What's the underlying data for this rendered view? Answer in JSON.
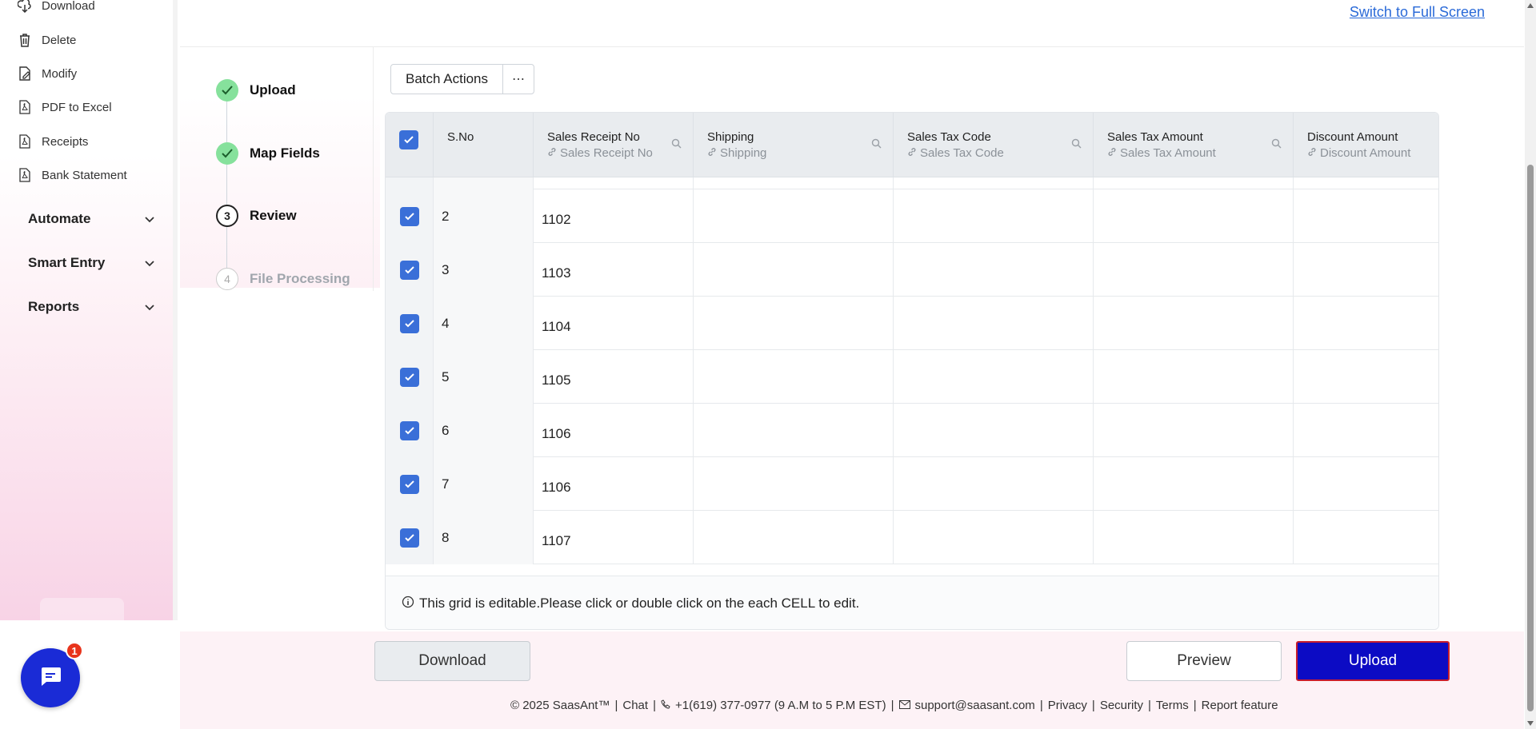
{
  "sidebar": {
    "items": [
      {
        "label": "Download",
        "icon": "cloud-download-icon"
      },
      {
        "label": "Delete",
        "icon": "trash-icon"
      },
      {
        "label": "Modify",
        "icon": "edit-file-icon"
      },
      {
        "label": "PDF to Excel",
        "icon": "pdf-file-icon"
      },
      {
        "label": "Receipts",
        "icon": "pdf-file-icon"
      },
      {
        "label": "Bank Statement",
        "icon": "pdf-file-icon"
      }
    ],
    "groups": [
      {
        "label": "Automate"
      },
      {
        "label": "Smart Entry"
      },
      {
        "label": "Reports"
      }
    ]
  },
  "chat": {
    "badge": "1"
  },
  "header": {
    "fullscreen_link": "Switch to Full Screen"
  },
  "stepper": {
    "steps": [
      {
        "num": "",
        "label": "Upload",
        "state": "done"
      },
      {
        "num": "",
        "label": "Map Fields",
        "state": "done"
      },
      {
        "num": "3",
        "label": "Review",
        "state": "active"
      },
      {
        "num": "4",
        "label": "File Processing",
        "state": "pending"
      }
    ]
  },
  "toolbar": {
    "batch_actions": "Batch Actions",
    "more": "⋯"
  },
  "grid": {
    "columns": [
      {
        "title": "S.No",
        "sub": ""
      },
      {
        "title": "Sales Receipt No",
        "sub": "Sales Receipt No"
      },
      {
        "title": "Shipping",
        "sub": "Shipping"
      },
      {
        "title": "Sales Tax Code",
        "sub": "Sales Tax Code"
      },
      {
        "title": "Sales Tax Amount",
        "sub": "Sales Tax Amount"
      },
      {
        "title": "Discount Amount",
        "sub": "Discount Amount"
      }
    ],
    "rows": [
      {
        "sno": "2",
        "receipt": "1102"
      },
      {
        "sno": "3",
        "receipt": "1103"
      },
      {
        "sno": "4",
        "receipt": "1104"
      },
      {
        "sno": "5",
        "receipt": "1105"
      },
      {
        "sno": "6",
        "receipt": "1106"
      },
      {
        "sno": "7",
        "receipt": "1106"
      },
      {
        "sno": "8",
        "receipt": "1107"
      }
    ],
    "partial_row_receipt": "....",
    "note": "This grid is editable.Please click or double click on the each CELL to edit."
  },
  "actions": {
    "download": "Download",
    "preview": "Preview",
    "upload": "Upload"
  },
  "footer": {
    "copyright": "© 2025 SaasAnt™",
    "chat": "Chat",
    "phone": "+1(619) 377-0977 (9 A.M to 5 P.M EST)",
    "email": "support@saasant.com",
    "privacy": "Privacy",
    "security": "Security",
    "terms": "Terms",
    "report": "Report feature"
  },
  "colors": {
    "accent": "#3a6fd8",
    "upload_button": "#0c0bc4",
    "step_done": "#86e19c",
    "link": "#2a6ad8"
  }
}
